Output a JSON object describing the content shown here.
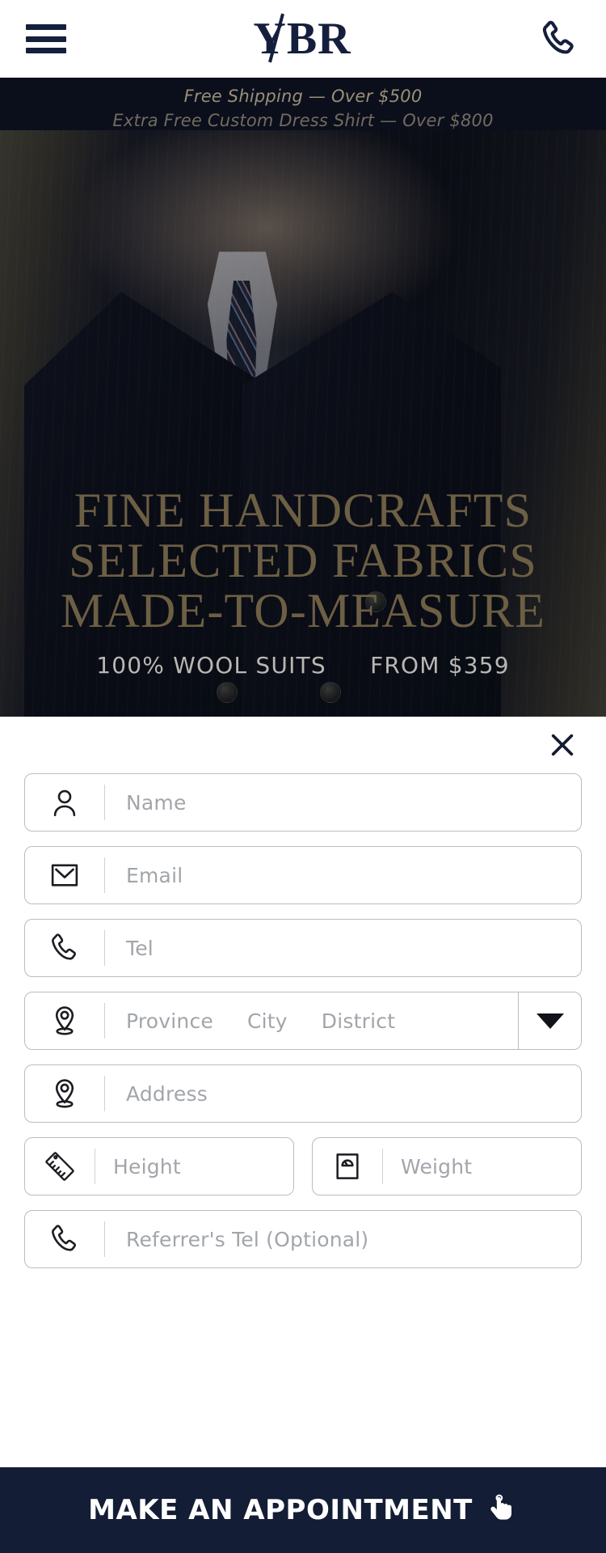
{
  "header": {
    "menu_icon": "hamburger-menu-icon",
    "brand": "YBR",
    "phone_icon": "phone-icon"
  },
  "announcement": {
    "line1": "Free Shipping — Over $500",
    "line2": "Extra Free Custom Dress Shirt — Over $800",
    "background": "#0b0f1c",
    "text_color": "#9a8e78"
  },
  "hero": {
    "headline_line1": "FINE HANDCRAFTS",
    "headline_line2": "SELECTED FABRICS",
    "headline_line3": "MADE-TO-MEASURE",
    "sub_left": "100% WOOL SUITS",
    "sub_right": "FROM $359",
    "headline_color": "#6d5f44",
    "sub_color": "#b9b7b3"
  },
  "form": {
    "close_icon": "close-icon",
    "fields": [
      {
        "name": "Name",
        "placeholder": "Name",
        "icon": "user-icon"
      },
      {
        "name": "Email",
        "placeholder": "Email",
        "icon": "envelope-icon"
      },
      {
        "name": "Tel",
        "placeholder": "Tel",
        "icon": "phone-icon"
      },
      {
        "name": "Address",
        "placeholder": "Address",
        "icon": "location-pin-icon"
      },
      {
        "name": "Height",
        "placeholder": "Height",
        "icon": "ruler-icon"
      },
      {
        "name": "Weight",
        "placeholder": "Weight",
        "icon": "scale-icon"
      },
      {
        "name": "Referrer",
        "placeholder": "Referrer's Tel (Optional)",
        "icon": "phone-icon"
      }
    ],
    "region": {
      "icon": "location-pin-icon",
      "province": "Province",
      "city": "City",
      "district": "District",
      "dropdown_icon": "caret-down-icon"
    }
  },
  "cta": {
    "label": "MAKE AN APPOINTMENT",
    "icon": "pointing-hand-icon",
    "background": "#131d35"
  }
}
